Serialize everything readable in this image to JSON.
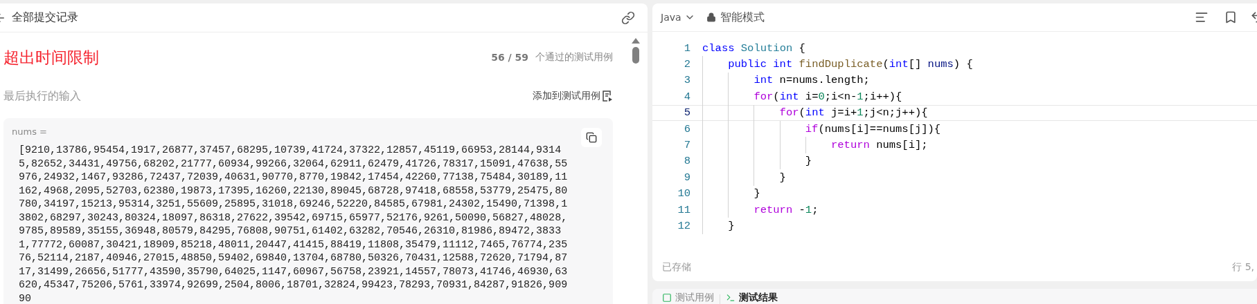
{
  "submission_panel": {
    "title": "全部提交记录"
  },
  "result": {
    "status": "超出时间限制",
    "passed": "56 / 59",
    "passed_label": "个通过的测试用例"
  },
  "last_input": {
    "label": "最后执行的输入",
    "add_button": "添加到测试用例",
    "param_name": "nums =",
    "value": "[9210,13786,95454,1917,26877,37457,68295,10739,41724,37322,12857,45119,66953,28144,93145,82652,34431,49756,68202,21777,60934,99266,32064,62911,62479,41726,78317,15091,47638,55976,24932,1467,93286,72437,72039,40631,90770,8770,19842,17454,42260,77138,75484,30189,11162,4968,2095,52703,62380,19873,17395,16260,22130,89045,68728,97418,68558,53779,25475,80780,34197,15213,95314,3251,55609,25895,31018,69246,52220,84585,67981,24302,15490,71398,13802,68297,30243,80324,18097,86318,27622,39542,69715,65977,52176,9261,50090,56827,48028,9785,89589,35155,36948,80579,84295,76808,90751,61402,63282,70546,26310,81986,89472,38331,77772,60087,30421,18909,85218,48011,20447,41415,88419,11808,35479,11112,7465,76774,23576,52114,2187,40946,27015,48850,59402,69840,13704,68780,50326,70431,12588,72620,71794,8717,31499,26656,51777,43590,35790,64025,1147,60967,56758,23921,14557,78073,41746,46930,63620,45347,75206,5761,33974,92699,2504,8006,18701,32824,99423,78293,70931,84287,91826,90990"
  },
  "editor": {
    "language": "Java",
    "mode": "智能模式",
    "lines": [
      {
        "number": "1",
        "current": false,
        "tokens": [
          {
            "kind": "keyword",
            "text": "class"
          },
          {
            "kind": "class",
            "text": " Solution"
          },
          {
            "kind": "plain",
            "text": " {"
          }
        ]
      },
      {
        "number": "2",
        "current": false,
        "tokens": [
          {
            "kind": "keyword",
            "text": "    public"
          },
          {
            "kind": "keyword",
            "text": " int"
          },
          {
            "kind": "function",
            "text": " findDuplicate"
          },
          {
            "kind": "plain",
            "text": "("
          },
          {
            "kind": "keyword",
            "text": "int"
          },
          {
            "kind": "plain",
            "text": "[] "
          },
          {
            "kind": "variable",
            "text": "nums"
          },
          {
            "kind": "plain",
            "text": ") {"
          }
        ]
      },
      {
        "number": "3",
        "current": false,
        "tokens": [
          {
            "kind": "keyword",
            "text": "        int"
          },
          {
            "kind": "plain",
            "text": " n=nums.length;"
          }
        ]
      },
      {
        "number": "4",
        "current": false,
        "tokens": [
          {
            "kind": "control",
            "text": "        for"
          },
          {
            "kind": "plain",
            "text": "("
          },
          {
            "kind": "keyword",
            "text": "int"
          },
          {
            "kind": "plain",
            "text": " i="
          },
          {
            "kind": "number",
            "text": "0"
          },
          {
            "kind": "plain",
            "text": ";i<n-"
          },
          {
            "kind": "number",
            "text": "1"
          },
          {
            "kind": "plain",
            "text": ";i++){"
          }
        ]
      },
      {
        "number": "5",
        "current": true,
        "tokens": [
          {
            "kind": "control",
            "text": "            for"
          },
          {
            "kind": "plain",
            "text": "("
          },
          {
            "kind": "keyword",
            "text": "int"
          },
          {
            "kind": "plain",
            "text": " j=i+"
          },
          {
            "kind": "number",
            "text": "1"
          },
          {
            "kind": "plain",
            "text": ";j<n;j++){"
          }
        ]
      },
      {
        "number": "6",
        "current": false,
        "tokens": [
          {
            "kind": "control",
            "text": "                if"
          },
          {
            "kind": "plain",
            "text": "(nums[i]==nums[j]){"
          }
        ]
      },
      {
        "number": "7",
        "current": false,
        "tokens": [
          {
            "kind": "control",
            "text": "                    return"
          },
          {
            "kind": "plain",
            "text": " nums[i];"
          }
        ]
      },
      {
        "number": "8",
        "current": false,
        "tokens": [
          {
            "kind": "plain",
            "text": "                }"
          }
        ]
      },
      {
        "number": "9",
        "current": false,
        "tokens": [
          {
            "kind": "plain",
            "text": "            }"
          }
        ]
      },
      {
        "number": "10",
        "current": false,
        "tokens": [
          {
            "kind": "plain",
            "text": "        }"
          }
        ]
      },
      {
        "number": "11",
        "current": false,
        "tokens": [
          {
            "kind": "control",
            "text": "        return"
          },
          {
            "kind": "plain",
            "text": " -"
          },
          {
            "kind": "number",
            "text": "1"
          },
          {
            "kind": "plain",
            "text": ";"
          }
        ]
      },
      {
        "number": "12",
        "current": false,
        "tokens": [
          {
            "kind": "plain",
            "text": "    }"
          }
        ]
      }
    ],
    "status": "已存储",
    "cursor": "行 5,"
  },
  "bottom_tabs": [
    {
      "label": "测试用例",
      "selected": false,
      "kind": "cases"
    },
    {
      "label": "测试结果",
      "selected": true,
      "kind": "terminal"
    }
  ]
}
